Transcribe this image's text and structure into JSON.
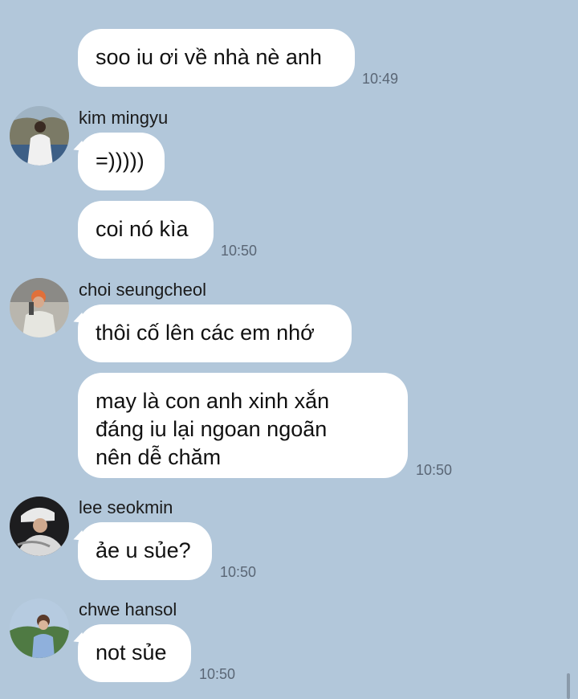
{
  "messages": [
    {
      "text": "soo iu ơi về nhà nè anh",
      "time": "10:49"
    },
    {
      "sender": "kim mingyu",
      "text": "=)))))"
    },
    {
      "text": "coi nó kìa",
      "time": "10:50"
    },
    {
      "sender": "choi seungcheol",
      "text": "thôi cố lên các em nhớ"
    },
    {
      "lines": [
        "may là con anh xinh xắn",
        "đáng iu lại ngoan ngoãn",
        "nên dễ chăm"
      ],
      "time": "10:50"
    },
    {
      "sender": "lee seokmin",
      "text": "ảe u sủe?",
      "time": "10:50"
    },
    {
      "sender": "chwe hansol",
      "text": "not sủe",
      "time": "10:50"
    }
  ],
  "avatars": [
    "avatar-kim-mingyu",
    "avatar-choi-seungcheol",
    "avatar-lee-seokmin",
    "avatar-chwe-hansol"
  ],
  "colors": {
    "background": "#b2c7da",
    "bubble": "#ffffff",
    "time": "#5a6675"
  }
}
